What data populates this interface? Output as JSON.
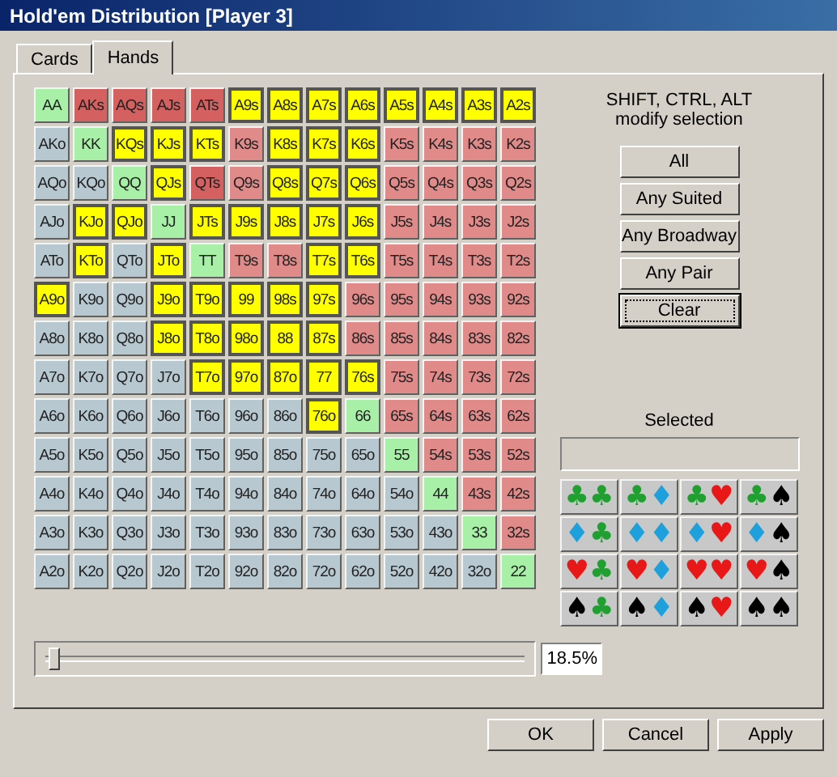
{
  "window": {
    "title": "Hold'em Distribution [Player 3]"
  },
  "tabs": [
    {
      "label": "Cards",
      "selected": false
    },
    {
      "label": "Hands",
      "selected": true
    }
  ],
  "grid": [
    [
      {
        "label": "AA",
        "color": "#a8f0a8",
        "selected": false
      },
      {
        "label": "AKs",
        "color": "#d46060",
        "selected": false
      },
      {
        "label": "AQs",
        "color": "#d46060",
        "selected": false
      },
      {
        "label": "AJs",
        "color": "#d46060",
        "selected": false
      },
      {
        "label": "ATs",
        "color": "#d46060",
        "selected": false
      },
      {
        "label": "A9s",
        "color": "#ffff00",
        "selected": true
      },
      {
        "label": "A8s",
        "color": "#ffff00",
        "selected": true
      },
      {
        "label": "A7s",
        "color": "#ffff00",
        "selected": true
      },
      {
        "label": "A6s",
        "color": "#ffff00",
        "selected": true
      },
      {
        "label": "A5s",
        "color": "#ffff00",
        "selected": true
      },
      {
        "label": "A4s",
        "color": "#ffff00",
        "selected": true
      },
      {
        "label": "A3s",
        "color": "#ffff00",
        "selected": true
      },
      {
        "label": "A2s",
        "color": "#ffff00",
        "selected": true
      }
    ],
    [
      {
        "label": "AKo",
        "color": "#b8c8d0",
        "selected": false
      },
      {
        "label": "KK",
        "color": "#a8f0a8",
        "selected": false
      },
      {
        "label": "KQs",
        "color": "#ffff00",
        "selected": true
      },
      {
        "label": "KJs",
        "color": "#ffff00",
        "selected": true
      },
      {
        "label": "KTs",
        "color": "#ffff00",
        "selected": true
      },
      {
        "label": "K9s",
        "color": "#e08a8a",
        "selected": false
      },
      {
        "label": "K8s",
        "color": "#ffff00",
        "selected": true
      },
      {
        "label": "K7s",
        "color": "#ffff00",
        "selected": true
      },
      {
        "label": "K6s",
        "color": "#ffff00",
        "selected": true
      },
      {
        "label": "K5s",
        "color": "#e08a8a",
        "selected": false
      },
      {
        "label": "K4s",
        "color": "#e08a8a",
        "selected": false
      },
      {
        "label": "K3s",
        "color": "#e08a8a",
        "selected": false
      },
      {
        "label": "K2s",
        "color": "#e08a8a",
        "selected": false
      }
    ],
    [
      {
        "label": "AQo",
        "color": "#b8c8d0",
        "selected": false
      },
      {
        "label": "KQo",
        "color": "#b8c8d0",
        "selected": false
      },
      {
        "label": "QQ",
        "color": "#a8f0a8",
        "selected": false
      },
      {
        "label": "QJs",
        "color": "#ffff00",
        "selected": true
      },
      {
        "label": "QTs",
        "color": "#d46060",
        "selected": false
      },
      {
        "label": "Q9s",
        "color": "#e08a8a",
        "selected": false
      },
      {
        "label": "Q8s",
        "color": "#ffff00",
        "selected": true
      },
      {
        "label": "Q7s",
        "color": "#ffff00",
        "selected": true
      },
      {
        "label": "Q6s",
        "color": "#ffff00",
        "selected": true
      },
      {
        "label": "Q5s",
        "color": "#e08a8a",
        "selected": false
      },
      {
        "label": "Q4s",
        "color": "#e08a8a",
        "selected": false
      },
      {
        "label": "Q3s",
        "color": "#e08a8a",
        "selected": false
      },
      {
        "label": "Q2s",
        "color": "#e08a8a",
        "selected": false
      }
    ],
    [
      {
        "label": "AJo",
        "color": "#b8c8d0",
        "selected": false
      },
      {
        "label": "KJo",
        "color": "#ffff00",
        "selected": true
      },
      {
        "label": "QJo",
        "color": "#ffff00",
        "selected": true
      },
      {
        "label": "JJ",
        "color": "#a8f0a8",
        "selected": false
      },
      {
        "label": "JTs",
        "color": "#ffff00",
        "selected": true
      },
      {
        "label": "J9s",
        "color": "#ffff00",
        "selected": true
      },
      {
        "label": "J8s",
        "color": "#ffff00",
        "selected": true
      },
      {
        "label": "J7s",
        "color": "#ffff00",
        "selected": true
      },
      {
        "label": "J6s",
        "color": "#ffff00",
        "selected": true
      },
      {
        "label": "J5s",
        "color": "#e08a8a",
        "selected": false
      },
      {
        "label": "J4s",
        "color": "#e08a8a",
        "selected": false
      },
      {
        "label": "J3s",
        "color": "#e08a8a",
        "selected": false
      },
      {
        "label": "J2s",
        "color": "#e08a8a",
        "selected": false
      }
    ],
    [
      {
        "label": "ATo",
        "color": "#b8c8d0",
        "selected": false
      },
      {
        "label": "KTo",
        "color": "#ffff00",
        "selected": true
      },
      {
        "label": "QTo",
        "color": "#b8c8d0",
        "selected": false
      },
      {
        "label": "JTo",
        "color": "#ffff00",
        "selected": true
      },
      {
        "label": "TT",
        "color": "#a8f0a8",
        "selected": false
      },
      {
        "label": "T9s",
        "color": "#e08a8a",
        "selected": false
      },
      {
        "label": "T8s",
        "color": "#e08a8a",
        "selected": false
      },
      {
        "label": "T7s",
        "color": "#ffff00",
        "selected": true
      },
      {
        "label": "T6s",
        "color": "#ffff00",
        "selected": true
      },
      {
        "label": "T5s",
        "color": "#e08a8a",
        "selected": false
      },
      {
        "label": "T4s",
        "color": "#e08a8a",
        "selected": false
      },
      {
        "label": "T3s",
        "color": "#e08a8a",
        "selected": false
      },
      {
        "label": "T2s",
        "color": "#e08a8a",
        "selected": false
      }
    ],
    [
      {
        "label": "A9o",
        "color": "#ffff00",
        "selected": true
      },
      {
        "label": "K9o",
        "color": "#b8c8d0",
        "selected": false
      },
      {
        "label": "Q9o",
        "color": "#b8c8d0",
        "selected": false
      },
      {
        "label": "J9o",
        "color": "#ffff00",
        "selected": true
      },
      {
        "label": "T9o",
        "color": "#ffff00",
        "selected": true
      },
      {
        "label": "99",
        "color": "#ffff00",
        "selected": true
      },
      {
        "label": "98s",
        "color": "#ffff00",
        "selected": true
      },
      {
        "label": "97s",
        "color": "#ffff00",
        "selected": true
      },
      {
        "label": "96s",
        "color": "#e08a8a",
        "selected": false
      },
      {
        "label": "95s",
        "color": "#e08a8a",
        "selected": false
      },
      {
        "label": "94s",
        "color": "#e08a8a",
        "selected": false
      },
      {
        "label": "93s",
        "color": "#e08a8a",
        "selected": false
      },
      {
        "label": "92s",
        "color": "#e08a8a",
        "selected": false
      }
    ],
    [
      {
        "label": "A8o",
        "color": "#b8c8d0",
        "selected": false
      },
      {
        "label": "K8o",
        "color": "#b8c8d0",
        "selected": false
      },
      {
        "label": "Q8o",
        "color": "#b8c8d0",
        "selected": false
      },
      {
        "label": "J8o",
        "color": "#ffff00",
        "selected": true
      },
      {
        "label": "T8o",
        "color": "#ffff00",
        "selected": true
      },
      {
        "label": "98o",
        "color": "#ffff00",
        "selected": true
      },
      {
        "label": "88",
        "color": "#ffff00",
        "selected": true
      },
      {
        "label": "87s",
        "color": "#ffff00",
        "selected": true
      },
      {
        "label": "86s",
        "color": "#e08a8a",
        "selected": false
      },
      {
        "label": "85s",
        "color": "#e08a8a",
        "selected": false
      },
      {
        "label": "84s",
        "color": "#e08a8a",
        "selected": false
      },
      {
        "label": "83s",
        "color": "#e08a8a",
        "selected": false
      },
      {
        "label": "82s",
        "color": "#e08a8a",
        "selected": false
      }
    ],
    [
      {
        "label": "A7o",
        "color": "#b8c8d0",
        "selected": false
      },
      {
        "label": "K7o",
        "color": "#b8c8d0",
        "selected": false
      },
      {
        "label": "Q7o",
        "color": "#b8c8d0",
        "selected": false
      },
      {
        "label": "J7o",
        "color": "#b8c8d0",
        "selected": false
      },
      {
        "label": "T7o",
        "color": "#ffff00",
        "selected": true
      },
      {
        "label": "97o",
        "color": "#ffff00",
        "selected": true
      },
      {
        "label": "87o",
        "color": "#ffff00",
        "selected": true
      },
      {
        "label": "77",
        "color": "#ffff00",
        "selected": true
      },
      {
        "label": "76s",
        "color": "#ffff00",
        "selected": true
      },
      {
        "label": "75s",
        "color": "#e08a8a",
        "selected": false
      },
      {
        "label": "74s",
        "color": "#e08a8a",
        "selected": false
      },
      {
        "label": "73s",
        "color": "#e08a8a",
        "selected": false
      },
      {
        "label": "72s",
        "color": "#e08a8a",
        "selected": false
      }
    ],
    [
      {
        "label": "A6o",
        "color": "#b8c8d0",
        "selected": false
      },
      {
        "label": "K6o",
        "color": "#b8c8d0",
        "selected": false
      },
      {
        "label": "Q6o",
        "color": "#b8c8d0",
        "selected": false
      },
      {
        "label": "J6o",
        "color": "#b8c8d0",
        "selected": false
      },
      {
        "label": "T6o",
        "color": "#b8c8d0",
        "selected": false
      },
      {
        "label": "96o",
        "color": "#b8c8d0",
        "selected": false
      },
      {
        "label": "86o",
        "color": "#b8c8d0",
        "selected": false
      },
      {
        "label": "76o",
        "color": "#ffff00",
        "selected": true
      },
      {
        "label": "66",
        "color": "#a8f0a8",
        "selected": false
      },
      {
        "label": "65s",
        "color": "#e08a8a",
        "selected": false
      },
      {
        "label": "64s",
        "color": "#e08a8a",
        "selected": false
      },
      {
        "label": "63s",
        "color": "#e08a8a",
        "selected": false
      },
      {
        "label": "62s",
        "color": "#e08a8a",
        "selected": false
      }
    ],
    [
      {
        "label": "A5o",
        "color": "#b8c8d0",
        "selected": false
      },
      {
        "label": "K5o",
        "color": "#b8c8d0",
        "selected": false
      },
      {
        "label": "Q5o",
        "color": "#b8c8d0",
        "selected": false
      },
      {
        "label": "J5o",
        "color": "#b8c8d0",
        "selected": false
      },
      {
        "label": "T5o",
        "color": "#b8c8d0",
        "selected": false
      },
      {
        "label": "95o",
        "color": "#b8c8d0",
        "selected": false
      },
      {
        "label": "85o",
        "color": "#b8c8d0",
        "selected": false
      },
      {
        "label": "75o",
        "color": "#b8c8d0",
        "selected": false
      },
      {
        "label": "65o",
        "color": "#b8c8d0",
        "selected": false
      },
      {
        "label": "55",
        "color": "#a8f0a8",
        "selected": false
      },
      {
        "label": "54s",
        "color": "#e08a8a",
        "selected": false
      },
      {
        "label": "53s",
        "color": "#e08a8a",
        "selected": false
      },
      {
        "label": "52s",
        "color": "#e08a8a",
        "selected": false
      }
    ],
    [
      {
        "label": "A4o",
        "color": "#b8c8d0",
        "selected": false
      },
      {
        "label": "K4o",
        "color": "#b8c8d0",
        "selected": false
      },
      {
        "label": "Q4o",
        "color": "#b8c8d0",
        "selected": false
      },
      {
        "label": "J4o",
        "color": "#b8c8d0",
        "selected": false
      },
      {
        "label": "T4o",
        "color": "#b8c8d0",
        "selected": false
      },
      {
        "label": "94o",
        "color": "#b8c8d0",
        "selected": false
      },
      {
        "label": "84o",
        "color": "#b8c8d0",
        "selected": false
      },
      {
        "label": "74o",
        "color": "#b8c8d0",
        "selected": false
      },
      {
        "label": "64o",
        "color": "#b8c8d0",
        "selected": false
      },
      {
        "label": "54o",
        "color": "#b8c8d0",
        "selected": false
      },
      {
        "label": "44",
        "color": "#a8f0a8",
        "selected": false
      },
      {
        "label": "43s",
        "color": "#e08a8a",
        "selected": false
      },
      {
        "label": "42s",
        "color": "#e08a8a",
        "selected": false
      }
    ],
    [
      {
        "label": "A3o",
        "color": "#b8c8d0",
        "selected": false
      },
      {
        "label": "K3o",
        "color": "#b8c8d0",
        "selected": false
      },
      {
        "label": "Q3o",
        "color": "#b8c8d0",
        "selected": false
      },
      {
        "label": "J3o",
        "color": "#b8c8d0",
        "selected": false
      },
      {
        "label": "T3o",
        "color": "#b8c8d0",
        "selected": false
      },
      {
        "label": "93o",
        "color": "#b8c8d0",
        "selected": false
      },
      {
        "label": "83o",
        "color": "#b8c8d0",
        "selected": false
      },
      {
        "label": "73o",
        "color": "#b8c8d0",
        "selected": false
      },
      {
        "label": "63o",
        "color": "#b8c8d0",
        "selected": false
      },
      {
        "label": "53o",
        "color": "#b8c8d0",
        "selected": false
      },
      {
        "label": "43o",
        "color": "#b8c8d0",
        "selected": false
      },
      {
        "label": "33",
        "color": "#a8f0a8",
        "selected": false
      },
      {
        "label": "32s",
        "color": "#e08a8a",
        "selected": false
      }
    ],
    [
      {
        "label": "A2o",
        "color": "#b8c8d0",
        "selected": false
      },
      {
        "label": "K2o",
        "color": "#b8c8d0",
        "selected": false
      },
      {
        "label": "Q2o",
        "color": "#b8c8d0",
        "selected": false
      },
      {
        "label": "J2o",
        "color": "#b8c8d0",
        "selected": false
      },
      {
        "label": "T2o",
        "color": "#b8c8d0",
        "selected": false
      },
      {
        "label": "92o",
        "color": "#b8c8d0",
        "selected": false
      },
      {
        "label": "82o",
        "color": "#b8c8d0",
        "selected": false
      },
      {
        "label": "72o",
        "color": "#b8c8d0",
        "selected": false
      },
      {
        "label": "62o",
        "color": "#b8c8d0",
        "selected": false
      },
      {
        "label": "52o",
        "color": "#b8c8d0",
        "selected": false
      },
      {
        "label": "42o",
        "color": "#b8c8d0",
        "selected": false
      },
      {
        "label": "32o",
        "color": "#b8c8d0",
        "selected": false
      },
      {
        "label": "22",
        "color": "#a8f0a8",
        "selected": false
      }
    ]
  ],
  "hint": [
    "SHIFT, CTRL, ALT",
    "modify selection"
  ],
  "actions": [
    "All",
    "Any Suited",
    "Any Broadway",
    "Any Pair",
    "Clear"
  ],
  "selected_label": "Selected",
  "suit_combos": [
    {
      "cards": [
        {
          "symbol": "♣",
          "color": "#20a030"
        },
        {
          "symbol": "♣",
          "color": "#20a030"
        }
      ]
    },
    {
      "cards": [
        {
          "symbol": "♣",
          "color": "#20a030"
        },
        {
          "symbol": "♦",
          "color": "#1ea0dc"
        }
      ]
    },
    {
      "cards": [
        {
          "symbol": "♣",
          "color": "#20a030"
        },
        {
          "symbol": "♥",
          "color": "#e81818"
        }
      ]
    },
    {
      "cards": [
        {
          "symbol": "♣",
          "color": "#20a030"
        },
        {
          "symbol": "♠",
          "color": "#000000"
        }
      ]
    },
    {
      "cards": [
        {
          "symbol": "♦",
          "color": "#1ea0dc"
        },
        {
          "symbol": "♣",
          "color": "#20a030"
        }
      ]
    },
    {
      "cards": [
        {
          "symbol": "♦",
          "color": "#1ea0dc"
        },
        {
          "symbol": "♦",
          "color": "#1ea0dc"
        }
      ]
    },
    {
      "cards": [
        {
          "symbol": "♦",
          "color": "#1ea0dc"
        },
        {
          "symbol": "♥",
          "color": "#e81818"
        }
      ]
    },
    {
      "cards": [
        {
          "symbol": "♦",
          "color": "#1ea0dc"
        },
        {
          "symbol": "♠",
          "color": "#000000"
        }
      ]
    },
    {
      "cards": [
        {
          "symbol": "♥",
          "color": "#e81818"
        },
        {
          "symbol": "♣",
          "color": "#20a030"
        }
      ]
    },
    {
      "cards": [
        {
          "symbol": "♥",
          "color": "#e81818"
        },
        {
          "symbol": "♦",
          "color": "#1ea0dc"
        }
      ]
    },
    {
      "cards": [
        {
          "symbol": "♥",
          "color": "#e81818"
        },
        {
          "symbol": "♥",
          "color": "#e81818"
        }
      ]
    },
    {
      "cards": [
        {
          "symbol": "♥",
          "color": "#e81818"
        },
        {
          "symbol": "♠",
          "color": "#000000"
        }
      ]
    },
    {
      "cards": [
        {
          "symbol": "♠",
          "color": "#000000"
        },
        {
          "symbol": "♣",
          "color": "#20a030"
        }
      ]
    },
    {
      "cards": [
        {
          "symbol": "♠",
          "color": "#000000"
        },
        {
          "symbol": "♦",
          "color": "#1ea0dc"
        }
      ]
    },
    {
      "cards": [
        {
          "symbol": "♠",
          "color": "#000000"
        },
        {
          "symbol": "♥",
          "color": "#e81818"
        }
      ]
    },
    {
      "cards": [
        {
          "symbol": "♠",
          "color": "#000000"
        },
        {
          "symbol": "♠",
          "color": "#000000"
        }
      ]
    }
  ],
  "slider": {
    "level": 0.02,
    "reading": "18.5%"
  },
  "buttons": [
    "OK",
    "Cancel",
    "Apply"
  ]
}
